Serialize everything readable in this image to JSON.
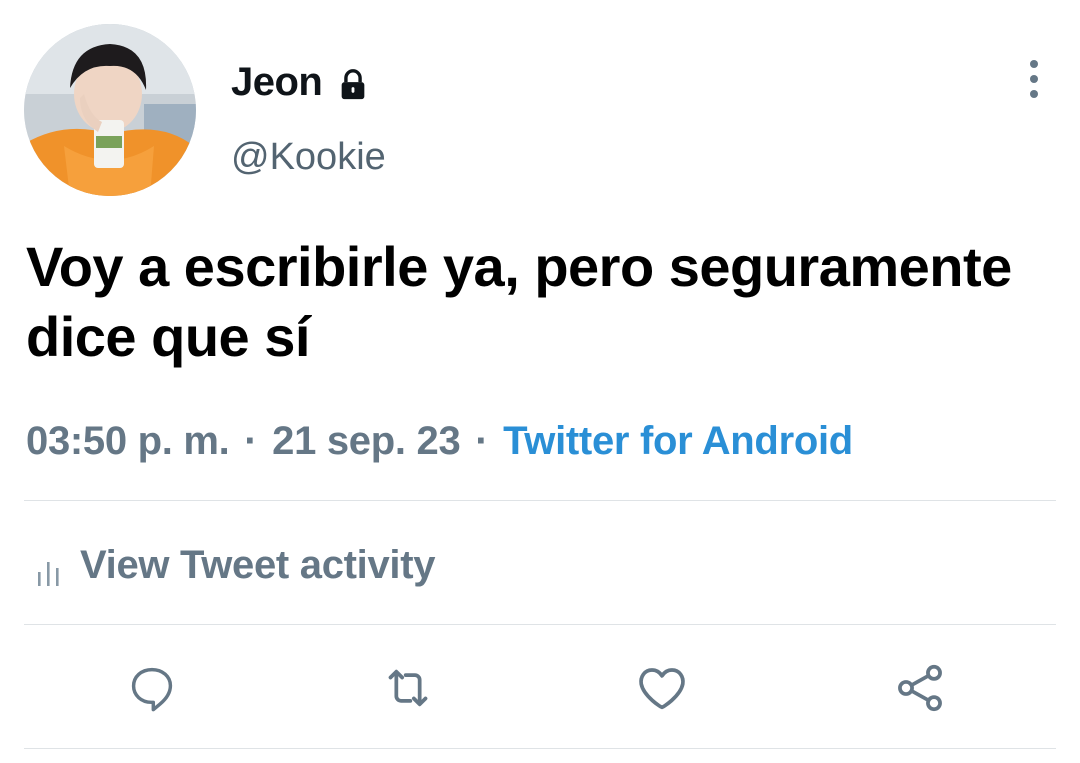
{
  "tweet": {
    "author": {
      "display_name": "Jeon",
      "username": "@Kookie",
      "protected_icon": "lock-icon",
      "avatar": "profile-photo"
    },
    "text": "Voy a escribirle ya, pero seguramente dice que sí",
    "time": "03:50 p. m.",
    "separator": "·",
    "date": "21 sep. 23",
    "source": "Twitter for Android",
    "activity_label": "View Tweet activity",
    "activity_icon": "bar-chart-icon",
    "more_icon": "more-vertical-icon"
  },
  "actions": [
    {
      "name": "reply",
      "icon": "reply-icon"
    },
    {
      "name": "retweet",
      "icon": "retweet-icon"
    },
    {
      "name": "like",
      "icon": "heart-icon"
    },
    {
      "name": "share",
      "icon": "share-icon"
    }
  ],
  "colors": {
    "text_primary": "#0f1419",
    "text_secondary": "#657786",
    "link": "#2a8fd6",
    "divider": "#dfe3e6",
    "icon": "#657786"
  }
}
